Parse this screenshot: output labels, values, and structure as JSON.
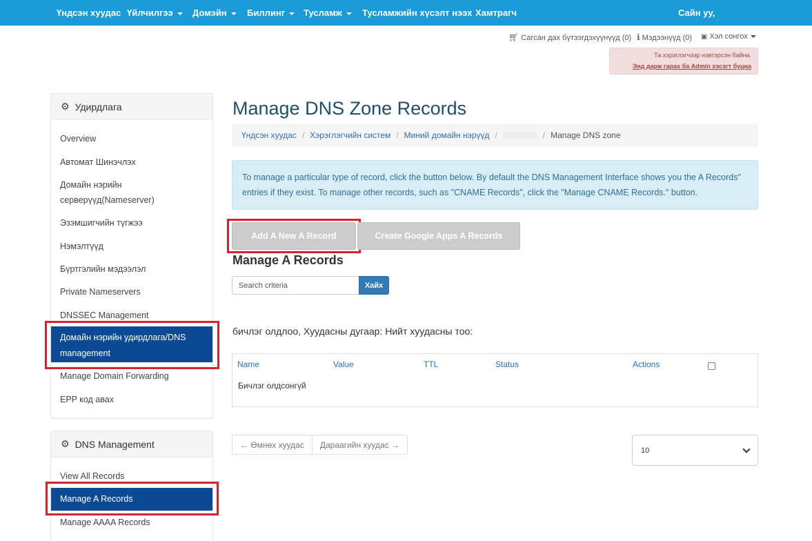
{
  "nav": {
    "items": [
      {
        "label": "Үндсэн хуудас",
        "dropdown": false
      },
      {
        "label": "Үйлчилгээ",
        "dropdown": true
      },
      {
        "label": "Домэйн",
        "dropdown": true
      },
      {
        "label": "Биллинг",
        "dropdown": true
      },
      {
        "label": "Тусламж",
        "dropdown": true
      },
      {
        "label": "Тусламжийн хүсэлт нээх",
        "dropdown": false
      },
      {
        "label": "Хамтрагч",
        "dropdown": false
      }
    ],
    "greeting": "Сайн уу,"
  },
  "utility": {
    "cart": "Сагсан дах бүтээгдэхүүнүүд (0)",
    "notifications": "Мэдээнүүд (0)",
    "language": "Хэл сонгох"
  },
  "admin_alert": {
    "message": "Та хэрэглэгчээр нэвтэрсэн байна.",
    "link": "Энд дарж гарах ба Admin хэсэгт буцна"
  },
  "sidebar": {
    "manage_panel": {
      "title": "Удирдлага",
      "items": [
        "Overview",
        "Автомат Шинэчлэх",
        "Домайн нэрийн серверүүд(Nameserver)",
        "Эзэмшигчийн түгжээ",
        "Нэмэлтүүд",
        "Бүртгэлийн мэдээлэл",
        "Private Nameservers",
        "DNSSEC Management",
        "Домайн нэрийн удирдлага/DNS management",
        "Manage Domain Forwarding",
        "EPP код авах"
      ],
      "active_index": 8
    },
    "dns_panel": {
      "title": "DNS Management",
      "items": [
        "View All Records",
        "Manage A Records",
        "Manage AAAA Records"
      ],
      "active_index": 1
    }
  },
  "main": {
    "title": "Manage DNS Zone Records",
    "breadcrumb": [
      "Үндсэн хуудас",
      "Хэрэглэгчийн систем",
      "Миний домайн нэрүүд",
      "Manage DNS zone"
    ],
    "info": "To manage a particular type of record, click the button below. By default the DNS Management Interface shows you the  A Records\" entries if they exist. To manage other records, such as \"CNAME Records\", click the \"Manage CNAME Records.\" button.",
    "buttons": {
      "add": "Add A New A Record",
      "google": "Create Google Apps A Records"
    },
    "section_title": "Manage A Records",
    "search": {
      "placeholder": "Search criteria",
      "button": "Хайх"
    },
    "records_found": "бичлэг олдлоо, Хуудасны дугаар: Нийт хуудасны тоо:",
    "table": {
      "headers": [
        "Name",
        "Value",
        "TTL",
        "Status",
        "Actions"
      ],
      "empty": "Бичлэг олдсонгүй"
    },
    "pager": {
      "prev": "← Өмнөх хуудас",
      "next": "Дараагийн хуудас →"
    },
    "per_page": "10"
  },
  "colors": {
    "nav": "#1a9ad6",
    "active": "#0d4a96",
    "highlight": "#d6232b"
  }
}
